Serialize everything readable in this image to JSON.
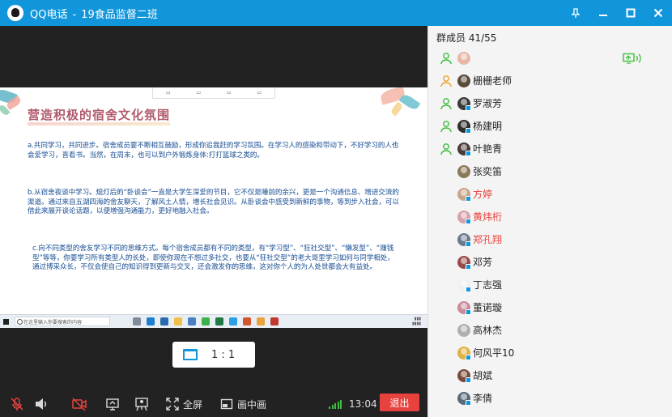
{
  "window": {
    "app_name": "QQ电话",
    "separator": "-",
    "group_name": "19食品监督二班"
  },
  "icons": {
    "logo": "qq-penguin-icon",
    "pin": "pin-icon",
    "minimize": "minimize-icon",
    "maximize": "maximize-icon",
    "close": "close-icon"
  },
  "shared_screen": {
    "title": "营造积极的宿舍文化氛围",
    "paragraphs": [
      "a.共同学习，共同进步。宿舍成员要不断相互鼓励，形成你追我赶的学习氛围。在学习人的感染和带动下，不好学习的人也会爱学习，喜看书。当然，在周末，也可以到户外锻炼身体:打打篮球之类的。",
      "b.从宿舍夜谈中学习。熄灯后的“卧谈会”一直是大学生深爱的节目，它不仅是睡前的余兴，更是一个沟通信息、增进交流的渠道。通过来自五湖四海的舍友聊天，了解风土人情，增长社会见识。从卧谈会中感受到新鲜的事物，等到步入社会，可以借此来展开谈论话题，以便增强沟通能力，更好地融入社会。",
      "c.向不同类型的舍友学习不同的思维方式。每个宿舍成员都有不同的类型，有“学习型”、“狂社交型”、“懒发型”、“赚钱型”等等，你要学习所有类型人的长处，即使你现在不想过多社交，也要从“狂社交型”的老大哥里学习如何与同学相处，通过博采众长，不仅会使自己的知识得到更新与交叉，还会激发你的思维，这对你个人的为人处世都会大有益处。"
    ],
    "taskbar_search": "在这里输入你要搜索的内容"
  },
  "ratio_button": {
    "label": "1 : 1",
    "icon": "screen-ratio-icon"
  },
  "toolbar": {
    "mic_icon": "mic-muted-icon",
    "speaker_icon": "speaker-icon",
    "camera_icon": "camera-off-icon",
    "share_icon": "screen-share-icon",
    "board_icon": "presentation-icon",
    "fullscreen_label": "全屏",
    "fullscreen_icon": "fullscreen-icon",
    "pip_label": "画中画",
    "pip_icon": "picture-in-picture-icon",
    "signal_icon": "signal-strength-icon",
    "call_time": "13:04",
    "exit_label": "退出"
  },
  "panel": {
    "header": "群成员 41/55",
    "members": [
      {
        "name": "",
        "role": "admin-green",
        "avatar_color": "#e8b7a8",
        "badge": false,
        "red": false,
        "sharing": true
      },
      {
        "name": "栅栅老师",
        "role": "owner-orange",
        "avatar_color": "#5a4a3a",
        "badge": false,
        "red": false,
        "sharing": false
      },
      {
        "name": "罗淑芳",
        "role": "admin-green",
        "avatar_color": "#3a3a3a",
        "badge": true,
        "red": false,
        "sharing": false
      },
      {
        "name": "杨建明",
        "role": "admin-green",
        "avatar_color": "#2f2f2f",
        "badge": true,
        "red": false,
        "sharing": false
      },
      {
        "name": "叶艳青",
        "role": "admin-green",
        "avatar_color": "#4a3a3a",
        "badge": true,
        "red": false,
        "sharing": false
      },
      {
        "name": "张奕笛",
        "role": "",
        "avatar_color": "#8a7a5a",
        "badge": false,
        "red": false,
        "sharing": false
      },
      {
        "name": "方婷",
        "role": "",
        "avatar_color": "#c9a58c",
        "badge": true,
        "red": true,
        "sharing": false
      },
      {
        "name": "黄炜桁",
        "role": "",
        "avatar_color": "#d8a0a8",
        "badge": true,
        "red": true,
        "sharing": false
      },
      {
        "name": "郑孔翔",
        "role": "",
        "avatar_color": "#6a7a8a",
        "badge": true,
        "red": true,
        "sharing": false
      },
      {
        "name": "邓芳",
        "role": "",
        "avatar_color": "#9a4a4a",
        "badge": true,
        "red": false,
        "sharing": false
      },
      {
        "name": "丁志强",
        "role": "",
        "avatar_color": "#f0f0f0",
        "badge": true,
        "red": false,
        "sharing": false
      },
      {
        "name": "董诺璇",
        "role": "",
        "avatar_color": "#c98a9a",
        "badge": true,
        "red": false,
        "sharing": false
      },
      {
        "name": "高林杰",
        "role": "",
        "avatar_color": "#b0b0b0",
        "badge": false,
        "red": false,
        "sharing": false
      },
      {
        "name": "何风平10",
        "role": "",
        "avatar_color": "#e0b040",
        "badge": true,
        "red": false,
        "sharing": false
      },
      {
        "name": "胡斌",
        "role": "",
        "avatar_color": "#7a4a3a",
        "badge": true,
        "red": false,
        "sharing": false
      },
      {
        "name": "李倩",
        "role": "",
        "avatar_color": "#5a6a7a",
        "badge": true,
        "red": false,
        "sharing": false
      }
    ]
  }
}
